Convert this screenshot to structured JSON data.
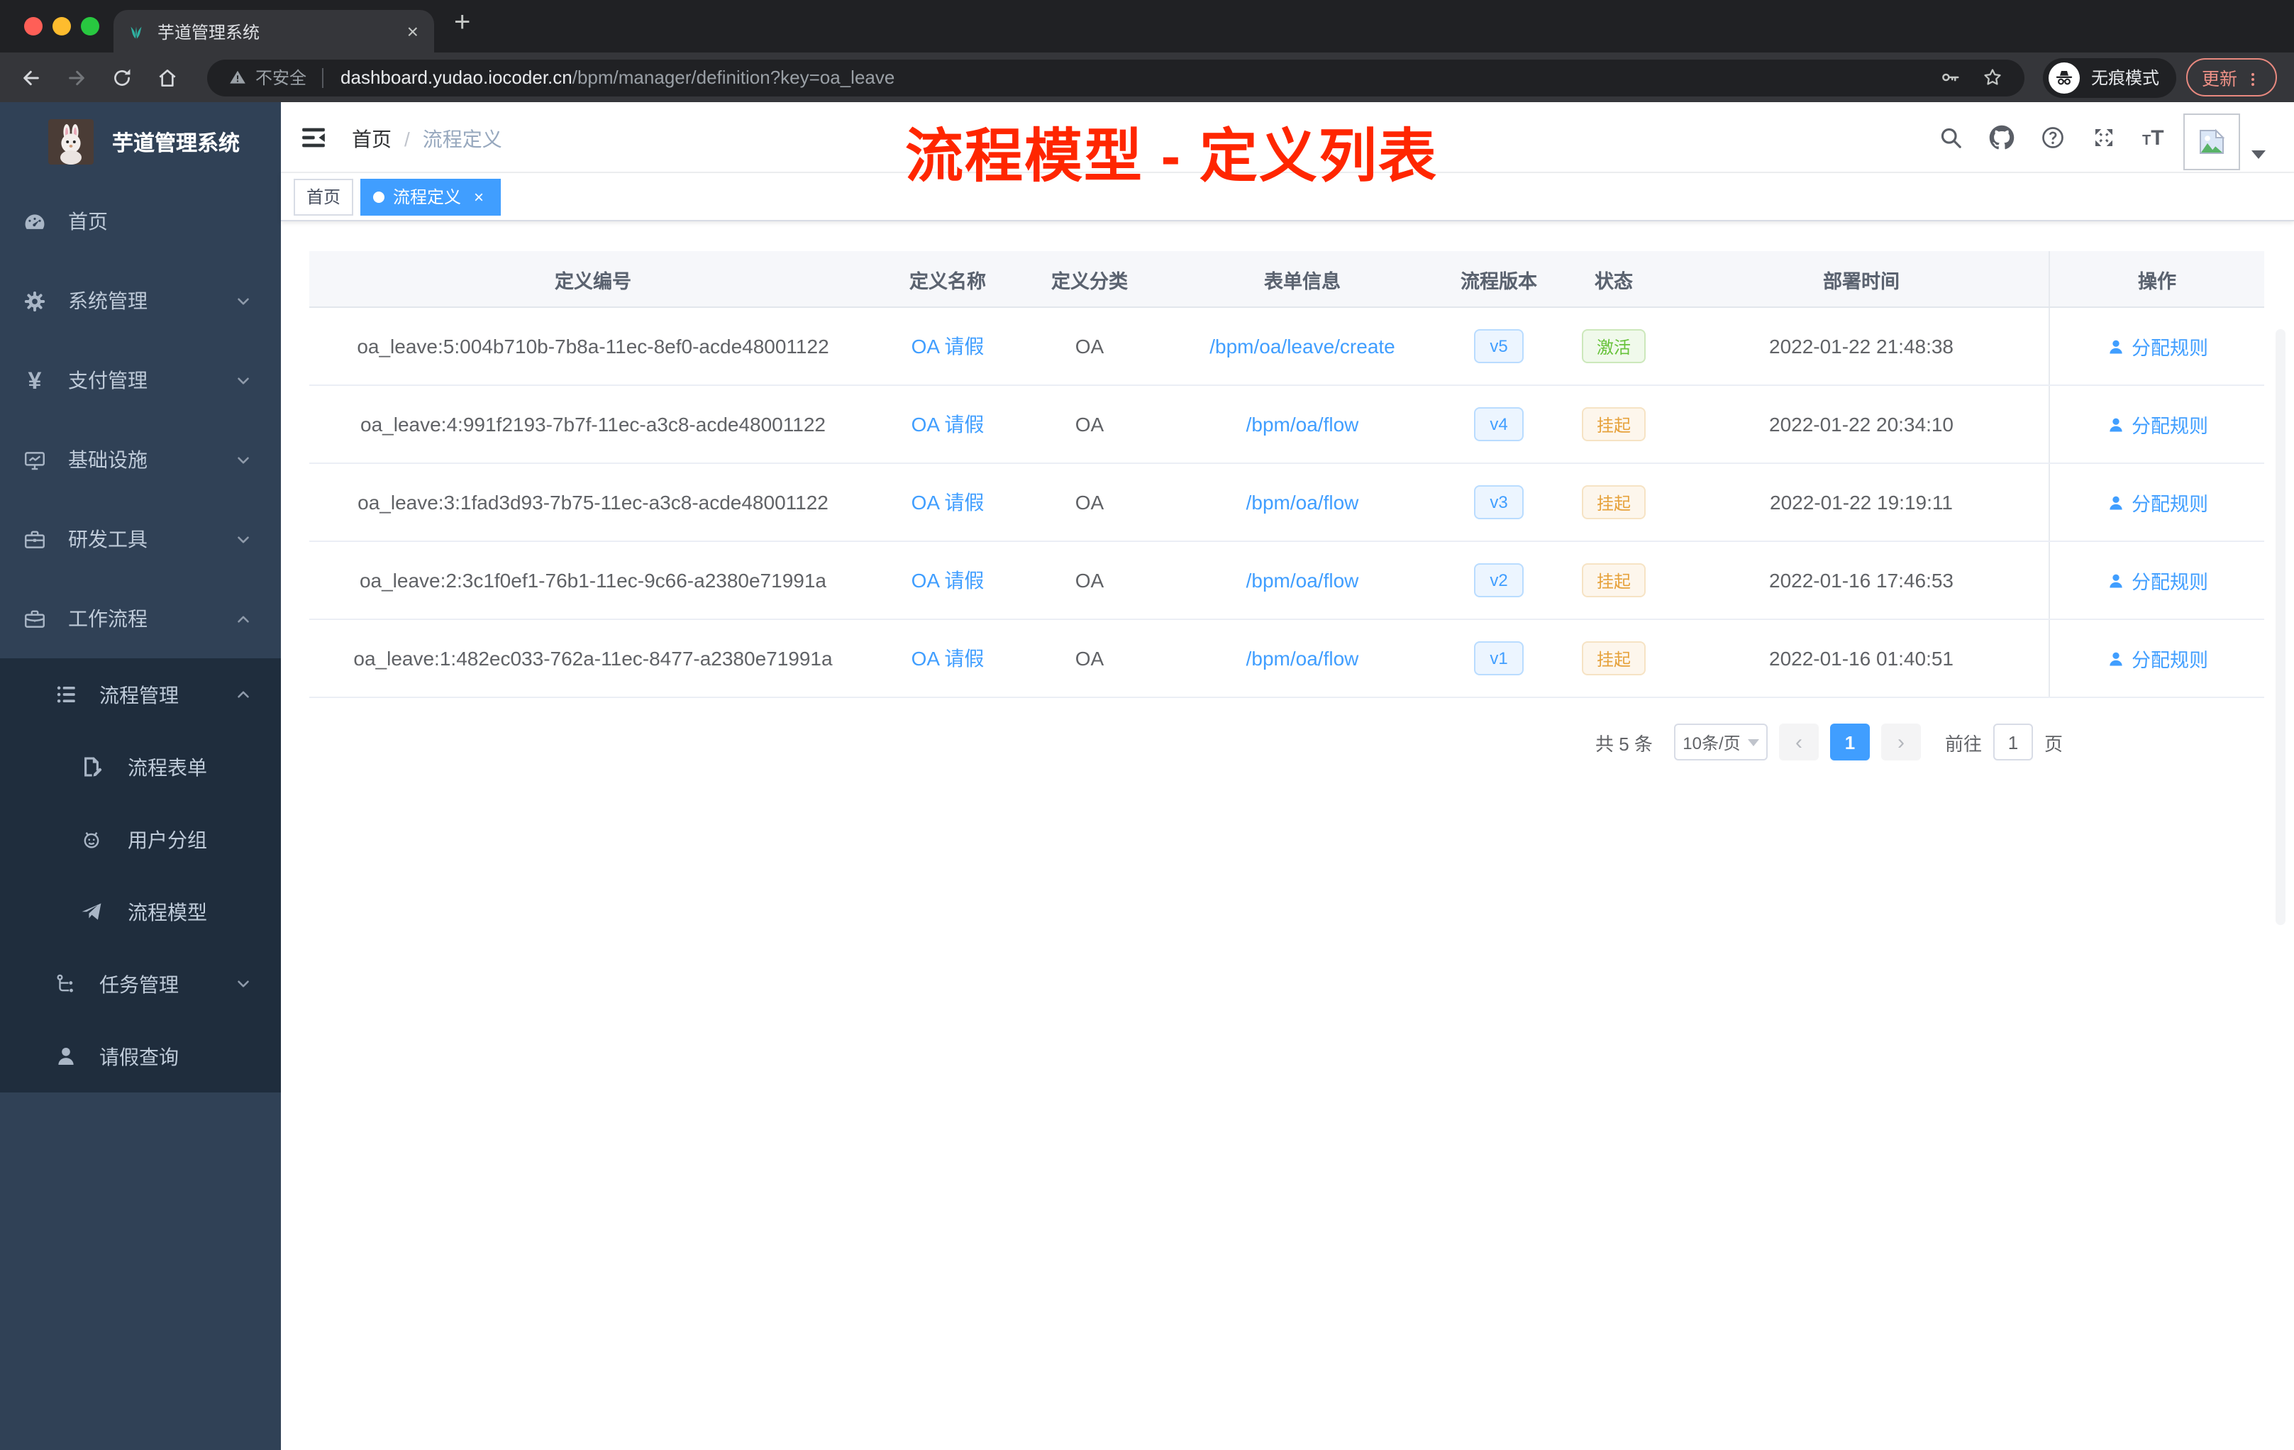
{
  "browser": {
    "traffic_lights": [
      "#ff5f57",
      "#febc2e",
      "#28c840"
    ],
    "tab": {
      "title": "芋道管理系统",
      "favicon": "plant-icon",
      "close_glyph": "×",
      "new_tab_glyph": "+"
    },
    "url": {
      "security_label": "不安全",
      "host": "dashboard.yudao.iocoder.cn",
      "path": "/bpm/manager/definition?key=oa_leave"
    },
    "incognito_label": "无痕模式",
    "update_label": "更新"
  },
  "sidebar": {
    "logo_title": "芋道管理系统",
    "items": [
      {
        "label": "首页",
        "icon": "dashboard-icon",
        "level": 1,
        "chevron": "",
        "dark": false
      },
      {
        "label": "系统管理",
        "icon": "gear-icon",
        "level": 1,
        "chevron": "down",
        "dark": false
      },
      {
        "label": "支付管理",
        "icon": "yen-icon",
        "level": 1,
        "chevron": "down",
        "dark": false
      },
      {
        "label": "基础设施",
        "icon": "monitor-icon",
        "level": 1,
        "chevron": "down",
        "dark": false
      },
      {
        "label": "研发工具",
        "icon": "toolbox-icon",
        "level": 1,
        "chevron": "down",
        "dark": false
      },
      {
        "label": "工作流程",
        "icon": "briefcase-icon",
        "level": 1,
        "chevron": "up",
        "dark": false
      },
      {
        "label": "流程管理",
        "icon": "list-tree-icon",
        "level": 2,
        "chevron": "up",
        "dark": true
      },
      {
        "label": "流程表单",
        "icon": "form-doc-icon",
        "level": 3,
        "chevron": "",
        "dark": true
      },
      {
        "label": "用户分组",
        "icon": "user-group-icon",
        "level": 3,
        "chevron": "",
        "dark": true
      },
      {
        "label": "流程模型",
        "icon": "paper-plane-icon",
        "level": 3,
        "chevron": "",
        "dark": true
      },
      {
        "label": "任务管理",
        "icon": "task-tree-icon",
        "level": 2,
        "chevron": "down",
        "dark": true
      },
      {
        "label": "请假查询",
        "icon": "person-icon",
        "level": 2,
        "chevron": "",
        "dark": true
      }
    ]
  },
  "header": {
    "breadcrumb_home": "首页",
    "breadcrumb_separator": "/",
    "breadcrumb_current": "流程定义",
    "actions": [
      "search-icon",
      "github-icon",
      "help-icon",
      "fullscreen-icon"
    ]
  },
  "tags": [
    {
      "label": "首页",
      "active": false,
      "closable": false
    },
    {
      "label": "流程定义",
      "active": true,
      "closable": true
    }
  ],
  "annotation": {
    "text": "流程模型 - 定义列表",
    "color": "#ff2600"
  },
  "table": {
    "columns": [
      "定义编号",
      "定义名称",
      "定义分类",
      "表单信息",
      "流程版本",
      "状态",
      "部署时间",
      "操作"
    ],
    "rows": [
      {
        "id": "oa_leave:5:004b710b-7b8a-11ec-8ef0-acde48001122",
        "name": "OA 请假",
        "category": "OA",
        "form": "/bpm/oa/leave/create",
        "version": "v5",
        "status": "激活",
        "status_type": "success",
        "deploy_time": "2022-01-22 21:48:38",
        "action": "分配规则"
      },
      {
        "id": "oa_leave:4:991f2193-7b7f-11ec-a3c8-acde48001122",
        "name": "OA 请假",
        "category": "OA",
        "form": "/bpm/oa/flow",
        "version": "v4",
        "status": "挂起",
        "status_type": "warning",
        "deploy_time": "2022-01-22 20:34:10",
        "action": "分配规则"
      },
      {
        "id": "oa_leave:3:1fad3d93-7b75-11ec-a3c8-acde48001122",
        "name": "OA 请假",
        "category": "OA",
        "form": "/bpm/oa/flow",
        "version": "v3",
        "status": "挂起",
        "status_type": "warning",
        "deploy_time": "2022-01-22 19:19:11",
        "action": "分配规则"
      },
      {
        "id": "oa_leave:2:3c1f0ef1-76b1-11ec-9c66-a2380e71991a",
        "name": "OA 请假",
        "category": "OA",
        "form": "/bpm/oa/flow",
        "version": "v2",
        "status": "挂起",
        "status_type": "warning",
        "deploy_time": "2022-01-16 17:46:53",
        "action": "分配规则"
      },
      {
        "id": "oa_leave:1:482ec033-762a-11ec-8477-a2380e71991a",
        "name": "OA 请假",
        "category": "OA",
        "form": "/bpm/oa/flow",
        "version": "v1",
        "status": "挂起",
        "status_type": "warning",
        "deploy_time": "2022-01-16 01:40:51",
        "action": "分配规则"
      }
    ],
    "accent_color": "#409eff",
    "status_colors": {
      "success": {
        "bg": "#f0f9eb",
        "border": "#cce8bb",
        "text": "#67c23a"
      },
      "warning": {
        "bg": "#fdf6ec",
        "border": "#f6e3c4",
        "text": "#e6a23c"
      }
    }
  },
  "pagination": {
    "total_label": "共 5 条",
    "page_size": "10条/页",
    "prev_glyph": "‹",
    "next_glyph": "›",
    "current_page": "1",
    "goto_label": "前往",
    "goto_value": "1",
    "unit_label": "页"
  }
}
